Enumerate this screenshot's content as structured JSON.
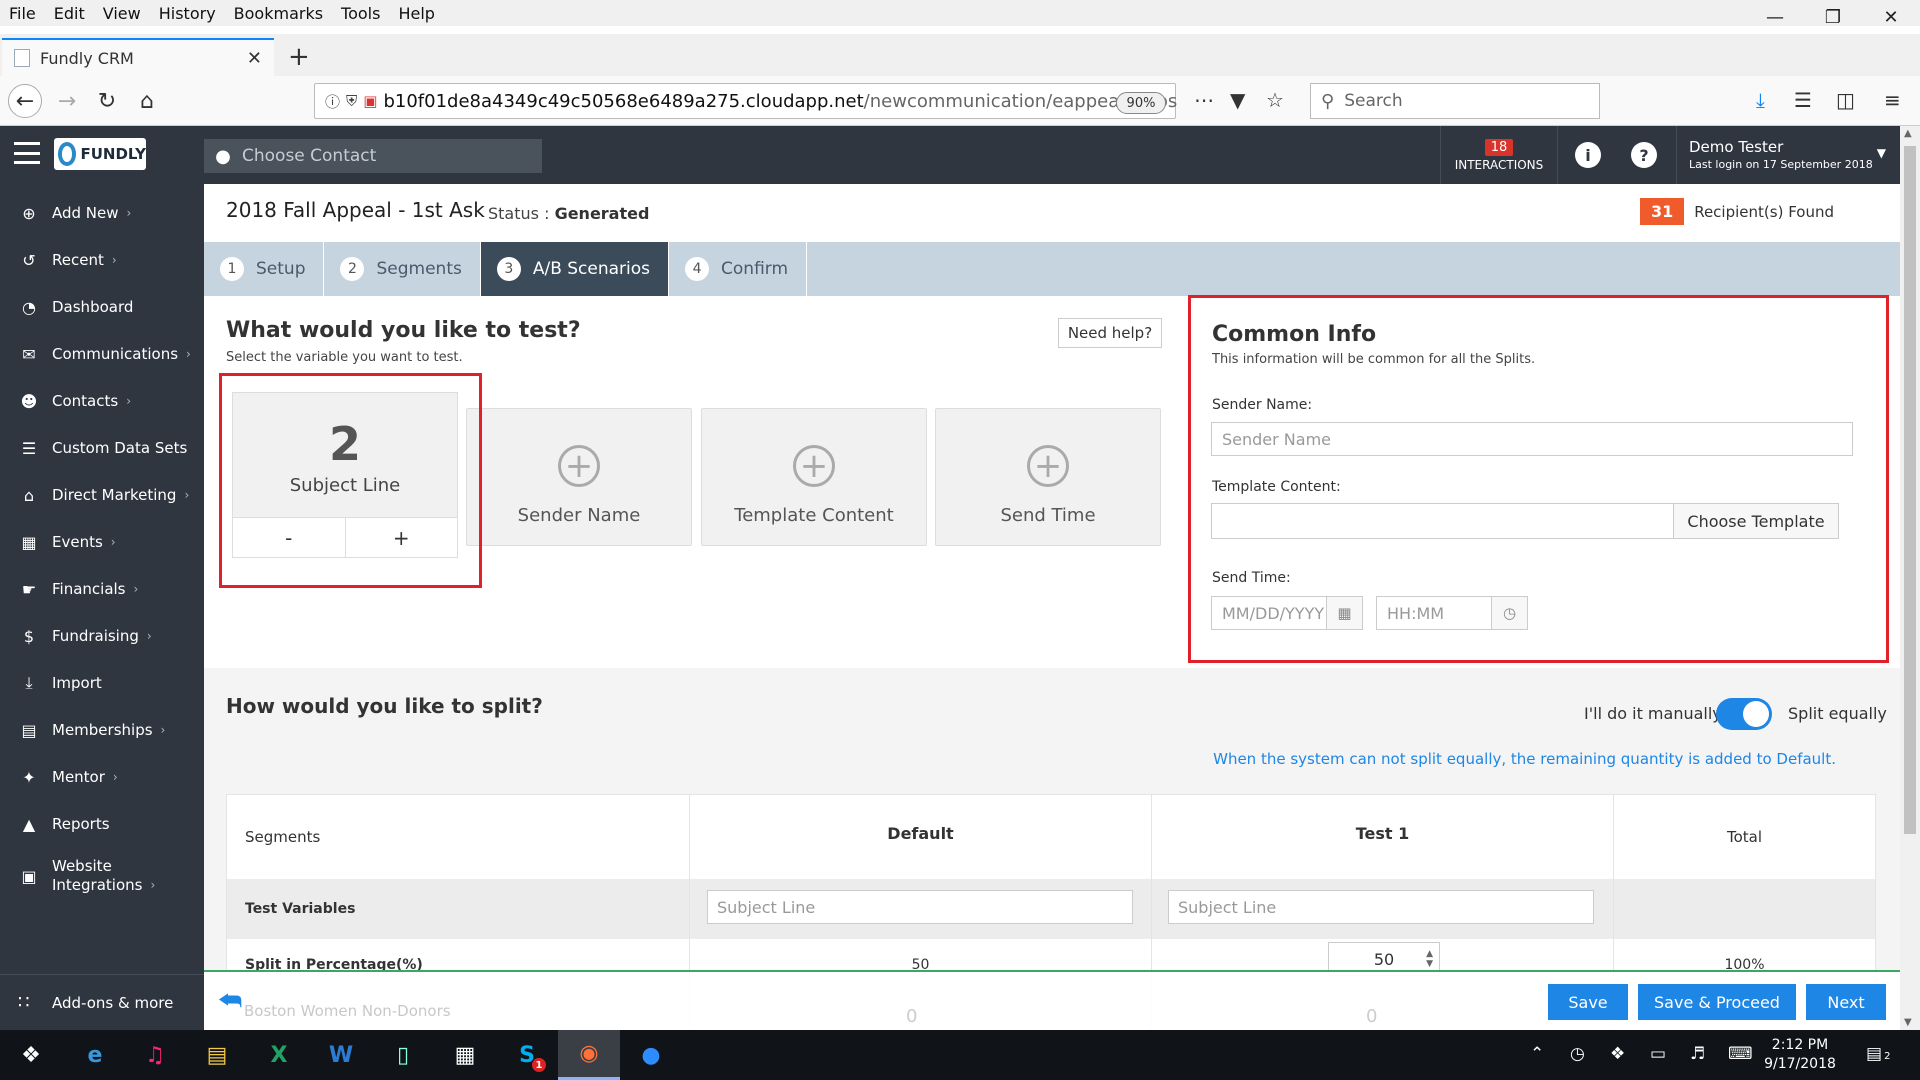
{
  "browser": {
    "menu": [
      "File",
      "Edit",
      "View",
      "History",
      "Bookmarks",
      "Tools",
      "Help"
    ],
    "tab_title": "Fundly CRM",
    "url_host": "b10f01de8a4349c49c50568e6489a275.cloudapp.net",
    "url_path": "/newcommunication/eappeal#/abs",
    "zoom": "90%",
    "search_placeholder": "Search"
  },
  "header": {
    "logo_text": "FUNDLY",
    "contact_placeholder": "Choose Contact",
    "interactions_count": "18",
    "interactions_label": "INTERACTIONS",
    "user_name": "Demo Tester",
    "last_login": "Last login on 17 September 2018"
  },
  "sidebar": {
    "items": [
      {
        "label": "Add New",
        "icon": "plus-circle-icon",
        "chevron": true
      },
      {
        "label": "Recent",
        "icon": "history-icon",
        "chevron": true
      },
      {
        "label": "Dashboard",
        "icon": "dashboard-icon",
        "chevron": false
      },
      {
        "label": "Communications",
        "icon": "envelope-icon",
        "chevron": true
      },
      {
        "label": "Contacts",
        "icon": "user-icon",
        "chevron": true
      },
      {
        "label": "Custom Data Sets",
        "icon": "database-icon",
        "chevron": false
      },
      {
        "label": "Direct Marketing",
        "icon": "bank-icon",
        "chevron": true
      },
      {
        "label": "Events",
        "icon": "calendar-icon",
        "chevron": true
      },
      {
        "label": "Financials",
        "icon": "handshake-icon",
        "chevron": true
      },
      {
        "label": "Fundraising",
        "icon": "money-bag-icon",
        "chevron": true
      },
      {
        "label": "Import",
        "icon": "import-icon",
        "chevron": false
      },
      {
        "label": "Memberships",
        "icon": "id-card-icon",
        "chevron": true
      },
      {
        "label": "Mentor",
        "icon": "mentor-icon",
        "chevron": true
      },
      {
        "label": "Reports",
        "icon": "chart-icon",
        "chevron": false
      },
      {
        "label1": "Website",
        "label2": "Integrations",
        "icon": "website-icon",
        "chevron": true
      }
    ],
    "addons": "Add-ons & more"
  },
  "page": {
    "title": "2018 Fall Appeal - 1st Ask",
    "status_label": "Status :",
    "status_value": "Generated",
    "recipients_count": "31",
    "recipients_label": "Recipient(s) Found"
  },
  "steps": [
    {
      "num": "1",
      "label": "Setup"
    },
    {
      "num": "2",
      "label": "Segments"
    },
    {
      "num": "3",
      "label": "A/B Scenarios"
    },
    {
      "num": "4",
      "label": "Confirm"
    }
  ],
  "test": {
    "heading": "What would you like to test?",
    "subtext": "Select the variable you want to test.",
    "help_button": "Need help?",
    "subject_count": "2",
    "subject_label": "Subject Line",
    "minus": "-",
    "plus": "+",
    "cards": [
      "Sender Name",
      "Template Content",
      "Send Time"
    ]
  },
  "common": {
    "heading": "Common Info",
    "subtext": "This information will be common for all the Splits.",
    "sender_label": "Sender Name:",
    "sender_placeholder": "Sender Name",
    "template_label": "Template Content:",
    "choose_template": "Choose Template",
    "sendtime_label": "Send Time:",
    "date_placeholder": "MM/DD/YYYY",
    "time_placeholder": "HH:MM"
  },
  "split": {
    "heading": "How would you like to split?",
    "manual_label": "I'll do it manually",
    "equal_label": "Split equally",
    "note": "When the system can not split equally, the remaining quantity is added to Default.",
    "columns": [
      "Segments",
      "Default",
      "Test 1",
      "Total"
    ],
    "row_test_variables": "Test Variables",
    "subject_placeholder": "Subject Line",
    "row_split_pct": "Split in Percentage(%)",
    "default_pct": "50",
    "test1_pct": "50",
    "total_pct": "100%",
    "segment_row": "Boston Women Non-Donors",
    "segment_default": "0",
    "segment_test1": "0"
  },
  "footer": {
    "save": "Save",
    "save_proceed": "Save & Proceed",
    "next": "Next"
  },
  "taskbar": {
    "time": "2:12 PM",
    "date": "9/17/2018",
    "notification_count": "2",
    "skype_badge": "1"
  },
  "colors": {
    "sidebar_bg": "#2f3640",
    "accent_blue": "#1e86e5",
    "highlight_red": "#e0202a",
    "recipients_orange": "#ef5b2b"
  }
}
